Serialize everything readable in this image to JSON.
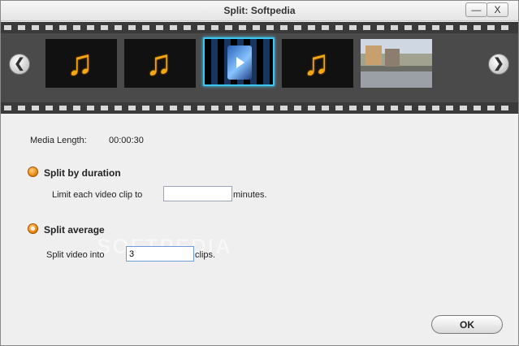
{
  "window": {
    "title": "Split: Softpedia",
    "minimize_label": "—",
    "close_label": "X"
  },
  "filmstrip": {
    "prev_label": "❮",
    "next_label": "❯",
    "thumbnails": [
      {
        "kind": "audio",
        "icon": "music-note-icon",
        "glyph": "♫"
      },
      {
        "kind": "audio",
        "icon": "music-note-icon",
        "glyph": "♫"
      },
      {
        "kind": "video",
        "icon": "video-file-icon",
        "selected": true
      },
      {
        "kind": "audio",
        "icon": "music-note-icon",
        "glyph": "♫"
      },
      {
        "kind": "video-frame",
        "icon": "street-photo-thumbnail"
      }
    ]
  },
  "media": {
    "length_label": "Media Length:",
    "length_value": "00:00:30"
  },
  "split_by_duration": {
    "label": "Split by duration",
    "limit_label": "Limit each video clip to",
    "limit_value": "",
    "unit_label": "minutes."
  },
  "split_average": {
    "label": "Split average",
    "split_label": "Split video into",
    "count_value": "3",
    "unit_label": "clips."
  },
  "watermark": "SOFTPEDIA",
  "buttons": {
    "ok_label": "OK"
  },
  "colors": {
    "selection_border": "#3ec6f0",
    "radio_orange": "#f08a10",
    "note_orange": "#f5a712"
  }
}
